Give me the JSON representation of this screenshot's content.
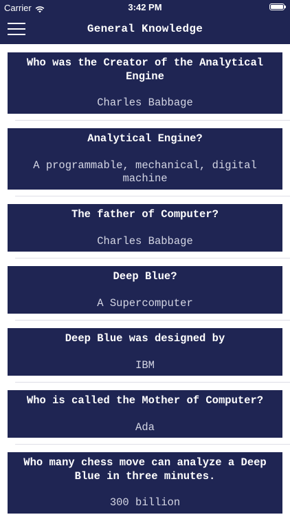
{
  "status_bar": {
    "carrier": "Carrier",
    "time": "3:42 PM",
    "icons": [
      "wifi-icon",
      "battery-icon"
    ]
  },
  "nav": {
    "title": "General Knowledge",
    "menu_icon": "hamburger-menu-icon"
  },
  "colors": {
    "card_background": "#1f2553",
    "header_background": "#1f2553",
    "text": "#ffffff",
    "separator": "#dedee6"
  },
  "cards": [
    {
      "question": "Who was the Creator of the Analytical Engine",
      "answer": "Charles Babbage"
    },
    {
      "question": "Analytical Engine?",
      "answer": "A programmable, mechanical, digital machine"
    },
    {
      "question": "The father of Computer?",
      "answer": "Charles Babbage"
    },
    {
      "question": "Deep Blue?",
      "answer": "A Supercomputer"
    },
    {
      "question": "Deep Blue was designed by",
      "answer": "IBM"
    },
    {
      "question": "Who is called the Mother of Computer?",
      "answer": "Ada"
    },
    {
      "question": "Who many chess move can analyze a Deep Blue in three minutes.",
      "answer": "300 billion"
    }
  ]
}
